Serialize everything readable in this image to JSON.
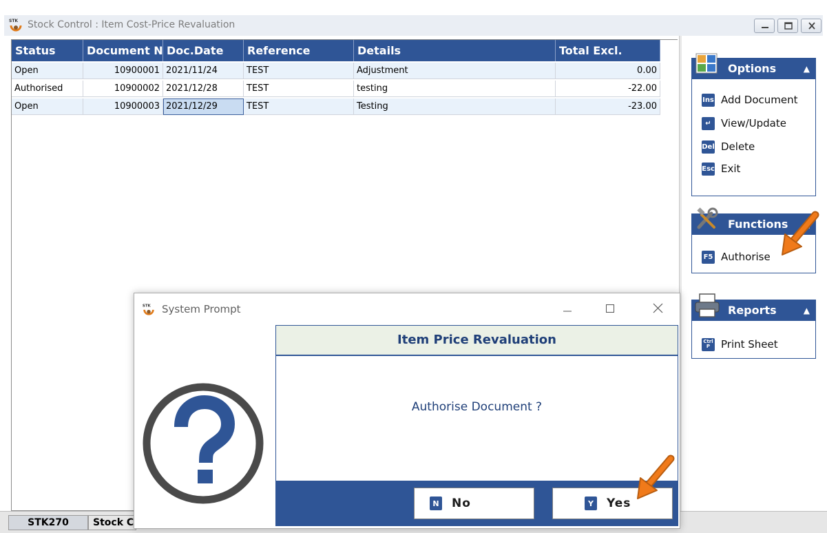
{
  "window": {
    "title": "Stock Control : Item Cost-Price Revaluation"
  },
  "grid": {
    "columns": [
      "Status",
      "Document N",
      "Doc.Date",
      "Reference",
      "Details",
      "Total Excl."
    ],
    "rows": [
      [
        "Open",
        "10900001",
        "2021/11/24",
        "TEST",
        "Adjustment",
        "0.00"
      ],
      [
        "Authorised",
        "10900002",
        "2021/12/28",
        "TEST",
        "testing",
        "-22.00"
      ],
      [
        "Open",
        "10900003",
        "2021/12/29",
        "TEST",
        "Testing",
        "-23.00"
      ]
    ]
  },
  "options": {
    "title": "Options",
    "items": [
      {
        "key": "Ins",
        "label": "Add Document"
      },
      {
        "key": "↵",
        "label": "View/Update"
      },
      {
        "key": "Del",
        "label": "Delete"
      },
      {
        "key": "Esc",
        "label": "Exit"
      }
    ]
  },
  "functions": {
    "title": "Functions",
    "items": [
      {
        "key": "F5",
        "label": "Authorise"
      }
    ]
  },
  "reports": {
    "title": "Reports",
    "items": [
      {
        "key": "Ctrl P",
        "label": "Print Sheet"
      }
    ]
  },
  "statusbar": {
    "code": "STK270",
    "module": "Stock C"
  },
  "dialog": {
    "title": "System Prompt",
    "header": "Item Price Revaluation",
    "message": "Authorise Document ?",
    "no": {
      "key": "N",
      "label": "No"
    },
    "yes": {
      "key": "Y",
      "label": "Yes"
    }
  },
  "colors": {
    "accent": "#2f5596",
    "header_bg": "#ebf1e6",
    "arrow": "#f07a1a"
  }
}
